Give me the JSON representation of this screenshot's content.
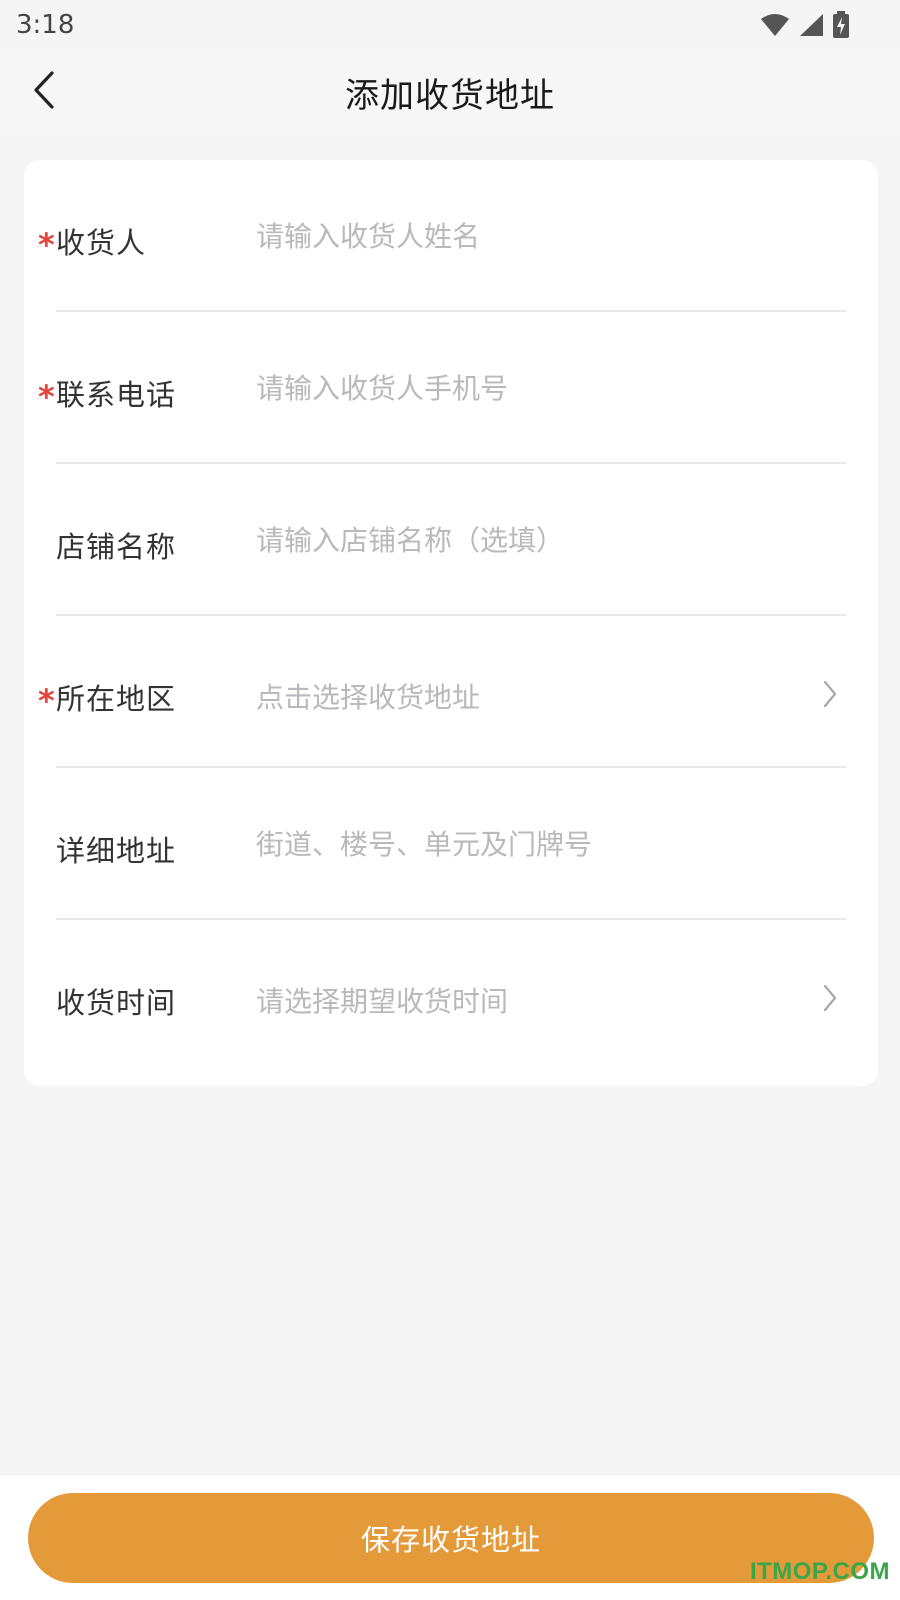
{
  "status_bar": {
    "time": "3:18",
    "icons": [
      "wifi-icon",
      "signal-icon",
      "battery-charging-icon"
    ]
  },
  "nav": {
    "back_icon": "chevron-left-icon",
    "title": "添加收货地址"
  },
  "form": {
    "rows": [
      {
        "label": "收货人",
        "required": true,
        "type": "input",
        "placeholder": "请输入收货人姓名",
        "value": ""
      },
      {
        "label": "联系电话",
        "required": true,
        "type": "input",
        "placeholder": "请输入收货人手机号",
        "value": ""
      },
      {
        "label": "店铺名称",
        "required": false,
        "type": "input",
        "placeholder": "请输入店铺名称（选填）",
        "value": ""
      },
      {
        "label": "所在地区",
        "required": true,
        "type": "select",
        "placeholder": "点击选择收货地址",
        "value": ""
      },
      {
        "label": "详细地址",
        "required": false,
        "type": "input",
        "placeholder": "街道、楼号、单元及门牌号",
        "value": ""
      },
      {
        "label": "收货时间",
        "required": false,
        "type": "select",
        "placeholder": "请选择期望收货时间",
        "value": ""
      }
    ],
    "required_mark": "*"
  },
  "bottom": {
    "save_label": "保存收货地址"
  },
  "watermark": "ITMOP.COM",
  "colors": {
    "accent": "#e59a3a",
    "required": "#e8423f",
    "placeholder": "#b9b9bd",
    "background": "#f5f5f5"
  }
}
